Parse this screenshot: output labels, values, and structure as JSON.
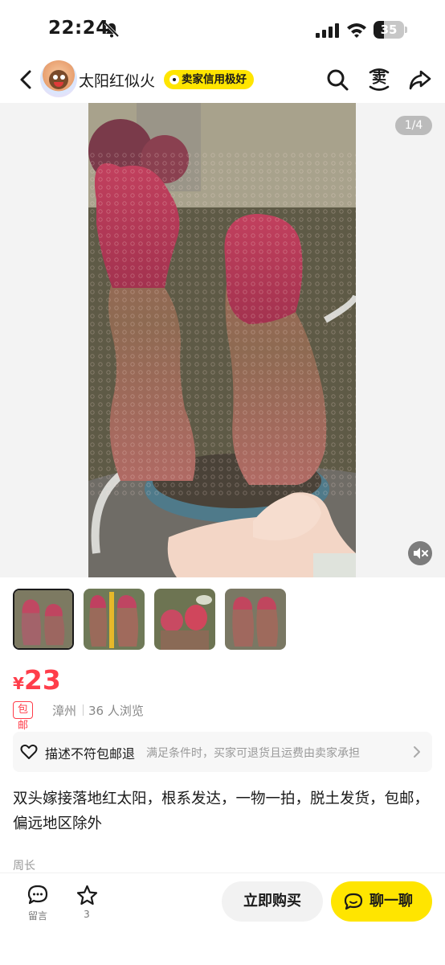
{
  "status_bar": {
    "time": "22:24",
    "battery_level": "35"
  },
  "nav": {
    "seller_name": "太阳红似火",
    "credit_badge": "卖家信用极好",
    "sell_icon_char": "卖",
    "icons": [
      "back-icon",
      "search-icon",
      "sell-icon",
      "share-icon"
    ]
  },
  "media": {
    "page_indicator": "1/4",
    "current_page": 1,
    "total_pages": 4,
    "thumbnail_count": 4,
    "selected_thumbnail": 0
  },
  "product": {
    "price_symbol": "¥",
    "price": "23",
    "free_shipping_tag": "包邮",
    "location": "漳州",
    "views": "36 人浏览",
    "description": "双头嫁接落地红太阳，根系发达，一物一拍，脱土发货，包邮，偏远地区除外",
    "author": "周长"
  },
  "guarantee": {
    "title": "描述不符包邮退",
    "description": "满足条件时，买家可退货且运费由卖家承担"
  },
  "bottom_bar": {
    "comment_label": "留言",
    "favorite_count": "3",
    "buy_label": "立即购买",
    "chat_label": "聊一聊"
  },
  "colors": {
    "accent_yellow": "#ffe500",
    "price_red": "#ff3d4a"
  }
}
